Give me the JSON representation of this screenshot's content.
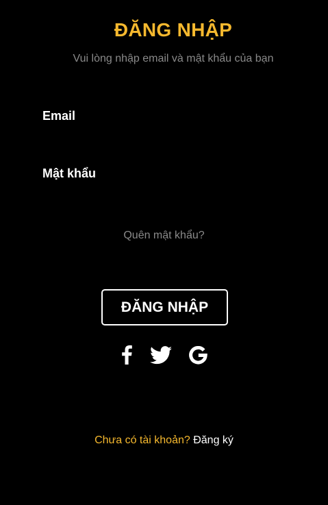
{
  "header": {
    "title": "ĐĂNG NHẬP",
    "subtitle": "Vui lòng nhập email và mật khẩu của bạn"
  },
  "form": {
    "email_label": "Email",
    "email_value": "",
    "password_label": "Mật khẩu",
    "password_value": "",
    "forgot_password": "Quên mật khẩu?",
    "submit_label": "ĐĂNG NHẬP"
  },
  "social": {
    "icons": [
      "facebook-icon",
      "twitter-icon",
      "google-icon"
    ]
  },
  "footer": {
    "signup_prompt": "Chưa có tài khoản?",
    "signup_link": "Đăng ký"
  },
  "colors": {
    "background": "#000000",
    "accent": "#f5b82e",
    "muted_text": "#8a8a8a",
    "text": "#ffffff"
  }
}
